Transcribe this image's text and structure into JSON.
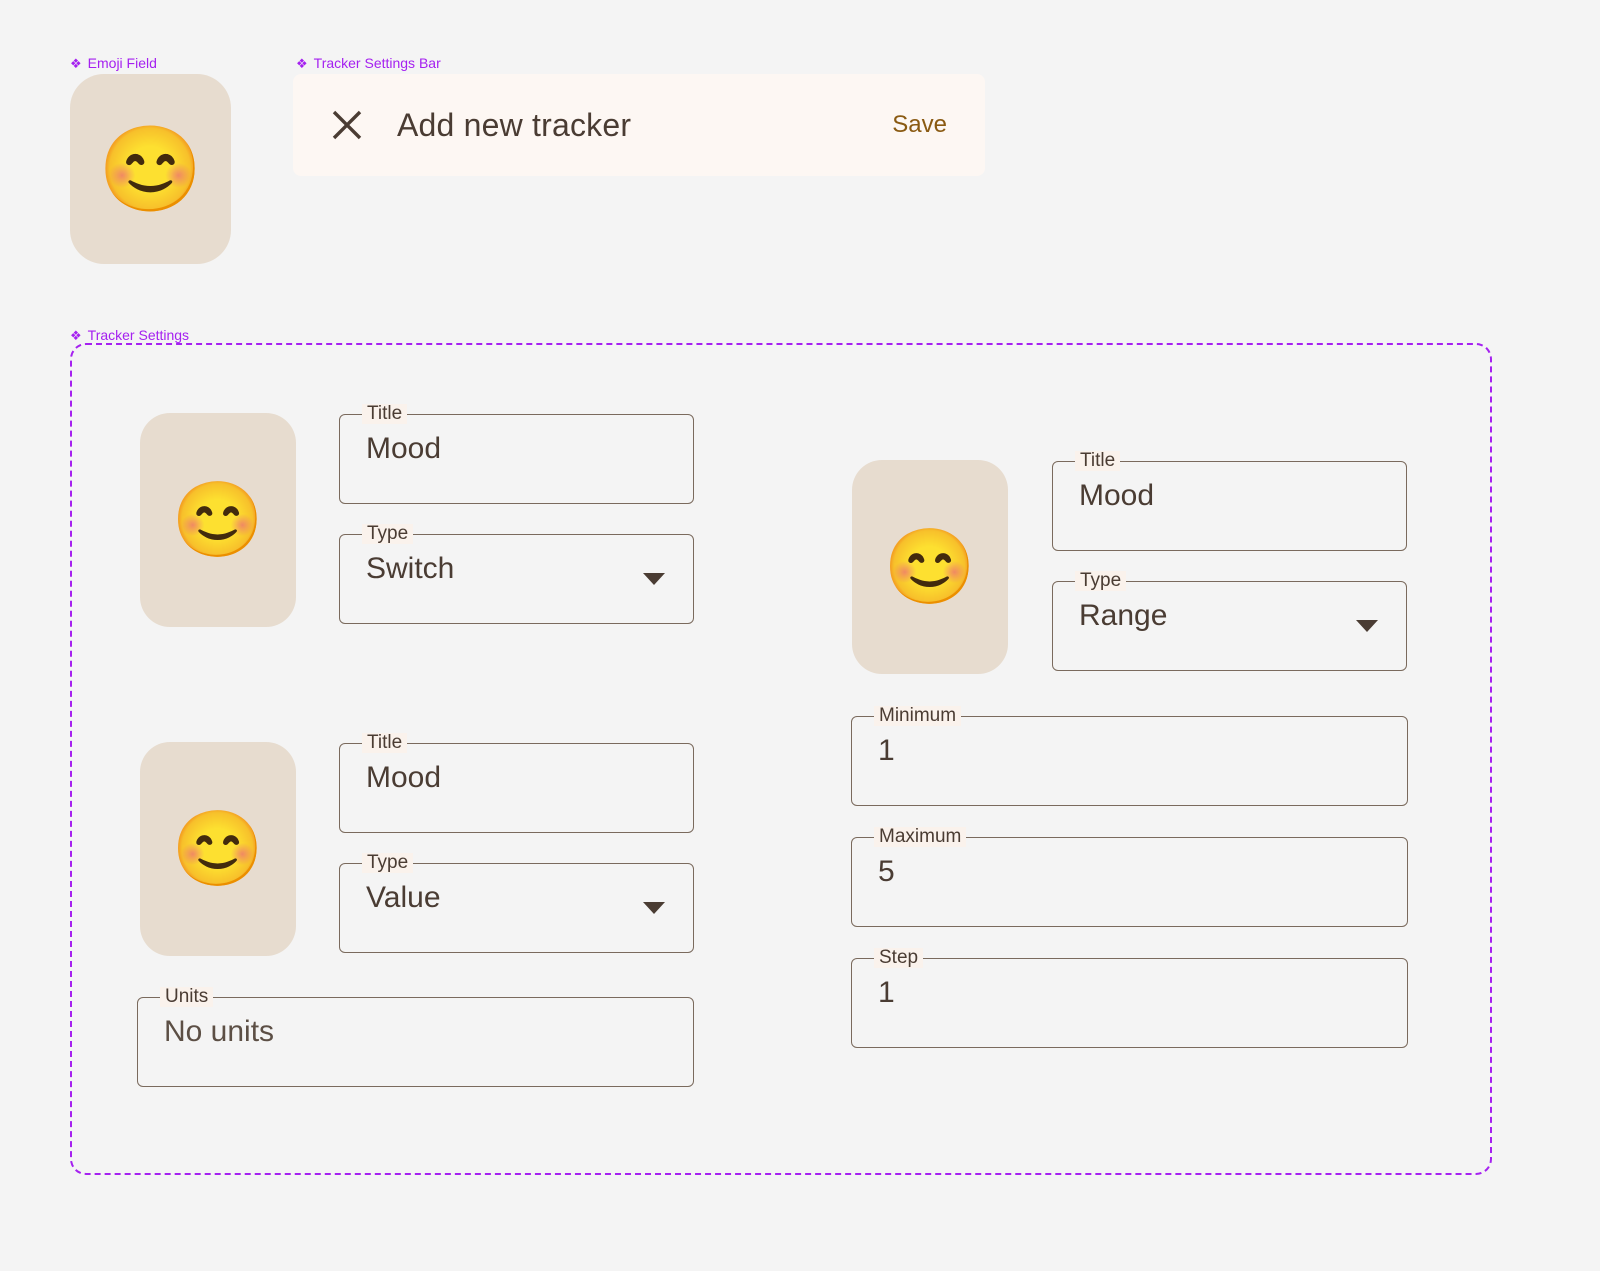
{
  "annotations": {
    "emoji_field": "Emoji Field",
    "tracker_settings_bar": "Tracker Settings Bar",
    "tracker_settings": "Tracker Settings",
    "sparkle_glyph": "❖"
  },
  "emoji_field": {
    "emoji": "😊",
    "icon_name": "smiling-face-with-smiling-eyes"
  },
  "settings_bar": {
    "close_icon": "close-icon",
    "title": "Add new tracker",
    "save_label": "Save"
  },
  "trackers": [
    {
      "emoji": "😊",
      "fields": [
        {
          "label": "Title",
          "value": "Mood",
          "control": "text"
        },
        {
          "label": "Type",
          "value": "Switch",
          "control": "select"
        }
      ]
    },
    {
      "emoji": "😊",
      "fields": [
        {
          "label": "Title",
          "value": "Mood",
          "control": "text"
        },
        {
          "label": "Type",
          "value": "Range",
          "control": "select"
        },
        {
          "label": "Minimum",
          "value": "1",
          "control": "text"
        },
        {
          "label": "Maximum",
          "value": "5",
          "control": "text"
        },
        {
          "label": "Step",
          "value": "1",
          "control": "text"
        }
      ]
    },
    {
      "emoji": "😊",
      "fields": [
        {
          "label": "Title",
          "value": "Mood",
          "control": "text"
        },
        {
          "label": "Type",
          "value": "Value",
          "control": "select"
        },
        {
          "label": "Units",
          "value": "No units",
          "control": "text"
        }
      ]
    }
  ],
  "colors": {
    "page_background": "#f4f4f4",
    "annotation_purple": "#a521f0",
    "tile_beige": "#e7dccf",
    "bar_cream": "#fdf7f3",
    "text_brown": "#4a3c33",
    "save_amber": "#8a5a12",
    "field_border": "#7a6a5d",
    "legend_background": "#faf2ec"
  }
}
